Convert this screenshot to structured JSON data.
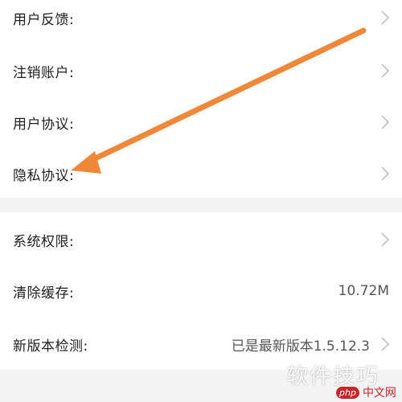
{
  "settings": {
    "group1": [
      {
        "label": "用户反馈:",
        "has_chevron": true
      },
      {
        "label": "注销账户:",
        "has_chevron": true
      },
      {
        "label": "用户协议:",
        "has_chevron": true
      },
      {
        "label": "隐私协议:",
        "has_chevron": true
      }
    ],
    "group2": [
      {
        "label": "系统权限:",
        "has_chevron": true
      },
      {
        "label": "清除缓存:",
        "value": "10.72M"
      },
      {
        "label": "新版本检测:",
        "value": "已是最新版本1.5.12.3",
        "has_chevron": true
      }
    ]
  },
  "annotation": {
    "color": "#f0883a",
    "icon": "arrow-pointer"
  },
  "watermark": {
    "text": "软件技巧",
    "badge": "php",
    "site": "中文网",
    "badge_color": "#c3272b"
  },
  "colors": {
    "background": "#f4f4f4",
    "card": "#ffffff",
    "chevron": "#c4c4c4"
  }
}
